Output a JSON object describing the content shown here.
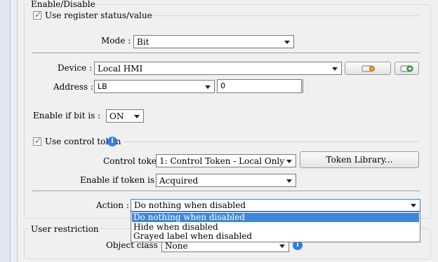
{
  "enable_disable": {
    "group_label": "Enable/Disable",
    "use_register": {
      "label": "Use register status/value",
      "checked": true
    },
    "mode": {
      "label": "Mode :",
      "value": "Bit"
    },
    "device": {
      "label": "Device :",
      "value": "Local HMI"
    },
    "address": {
      "label": "Address :",
      "type": "LB",
      "value": "0"
    },
    "enable_if_bit": {
      "label": "Enable if bit is :",
      "value": "ON"
    },
    "use_control_token": {
      "label": "Use control token",
      "checked": true
    },
    "control_token": {
      "label": "Control token :",
      "value": "1: Control Token - Local Only",
      "library_button": "Token Library..."
    },
    "enable_if_token": {
      "label": "Enable if token is :",
      "value": "Acquired"
    },
    "action": {
      "label": "Action :",
      "value": "Do nothing when disabled",
      "options": [
        "Do nothing when disabled",
        "Hide when disabled",
        "Grayed label when disabled"
      ]
    }
  },
  "user_restriction": {
    "group_label": "User restriction",
    "object_class": {
      "label": "Object class :",
      "value": "None"
    }
  },
  "icons": {
    "device_setting": "device-settings-icon",
    "add_device": "add-device-icon",
    "info": "info-icon"
  },
  "colors": {
    "accent": "#2f7fde",
    "highlight": "#3f86d8"
  }
}
